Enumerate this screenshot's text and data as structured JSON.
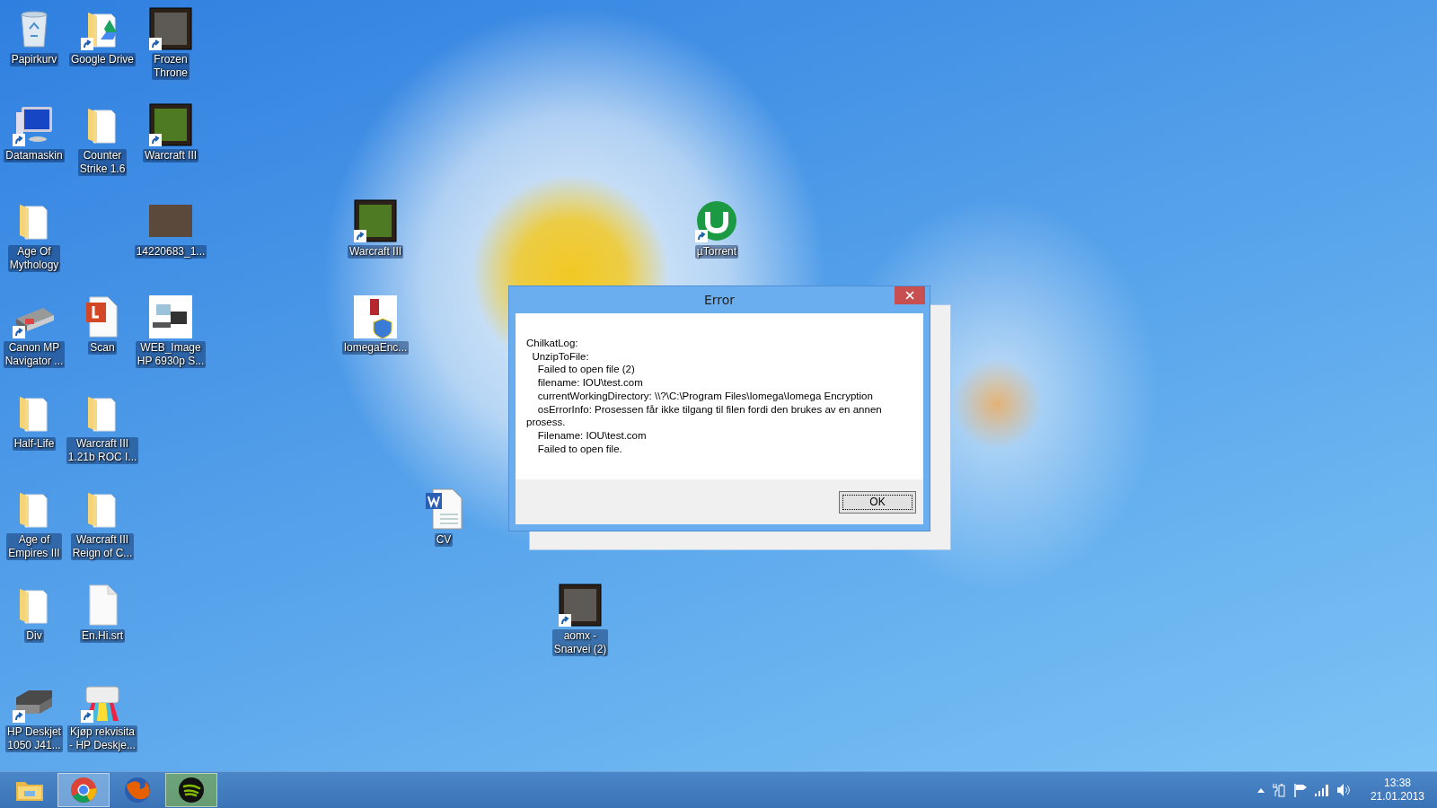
{
  "desktop_icons": [
    {
      "label": "Papirkurv",
      "kind": "recycle-bin",
      "shortcut": false
    },
    {
      "label": "Google Drive",
      "kind": "folder-drive",
      "shortcut": true
    },
    {
      "label": "Frozen\nThrone",
      "kind": "game-art",
      "shortcut": true
    },
    {
      "label": "Datamaskin",
      "kind": "computer",
      "shortcut": true
    },
    {
      "label": "Counter\nStrike 1.6",
      "kind": "folder",
      "shortcut": false
    },
    {
      "label": "Warcraft III",
      "kind": "game-art-green",
      "shortcut": true
    },
    {
      "label": "Age Of\nMythology",
      "kind": "folder",
      "shortcut": false
    },
    {
      "label": "14220683_1...",
      "kind": "photo",
      "shortcut": false
    },
    {
      "label": "Warcraft III",
      "kind": "game-art-green",
      "shortcut": true
    },
    {
      "label": "µTorrent",
      "kind": "torrent",
      "shortcut": true
    },
    {
      "label": "Canon MP\nNavigator ...",
      "kind": "scanner",
      "shortcut": true
    },
    {
      "label": "Scan",
      "kind": "pdf-document",
      "shortcut": false
    },
    {
      "label": "WEB_Image\nHP 6930p S...",
      "kind": "devices-picture",
      "shortcut": false
    },
    {
      "label": "IomegaEnc...",
      "kind": "shield-app",
      "shortcut": false
    },
    {
      "label": "Half-Life",
      "kind": "folder",
      "shortcut": false
    },
    {
      "label": "Warcraft III\n1.21b ROC I...",
      "kind": "folder",
      "shortcut": false
    },
    {
      "label": "Age of\nEmpires III",
      "kind": "folder",
      "shortcut": false
    },
    {
      "label": "Warcraft III\nReign of C...",
      "kind": "folder",
      "shortcut": false
    },
    {
      "label": "CV",
      "kind": "word-document",
      "shortcut": false
    },
    {
      "label": "Div",
      "kind": "folder",
      "shortcut": false
    },
    {
      "label": "En.Hi.srt",
      "kind": "file",
      "shortcut": false
    },
    {
      "label": "aomx -\nSnarvei (2)",
      "kind": "game-art",
      "shortcut": true
    },
    {
      "label": "HP Deskjet\n1050 J41...",
      "kind": "printer",
      "shortcut": true
    },
    {
      "label": "Kjøp rekvisita\n- HP Deskje...",
      "kind": "color-printer",
      "shortcut": true
    }
  ],
  "dialog": {
    "title": "Error",
    "message": "ChilkatLog:\n  UnzipToFile:\n    Failed to open file (2)\n    filename: IOU\\test.com\n    currentWorkingDirectory: \\\\?\\C:\\Program Files\\Iomega\\Iomega Encryption\n    osErrorInfo: Prosessen får ikke tilgang til filen fordi den brukes av en annen\nprosess.\n    Filename: IOU\\test.com\n    Failed to open file.",
    "buttons": [
      "OK"
    ]
  },
  "taskbar": {
    "apps": [
      {
        "kind": "folder",
        "running": false
      },
      {
        "kind": "ring",
        "running": true
      },
      {
        "kind": "globe",
        "running": false
      },
      {
        "kind": "waves",
        "running": true
      }
    ],
    "tray": {
      "time": "13:38",
      "date": "21.01.2013"
    }
  }
}
